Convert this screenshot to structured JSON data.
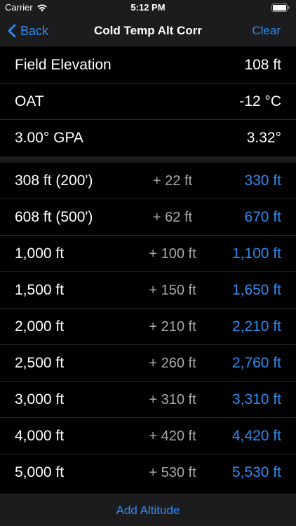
{
  "status": {
    "carrier": "Carrier",
    "time": "5:12 PM"
  },
  "nav": {
    "back_label": "Back",
    "title": "Cold Temp Alt Corr",
    "clear_label": "Clear"
  },
  "inputs": [
    {
      "label": "Field Elevation",
      "value": "108 ft"
    },
    {
      "label": "OAT",
      "value": "-12 °C"
    },
    {
      "label": "3.00° GPA",
      "value": "3.32°"
    }
  ],
  "altitudes": [
    {
      "altitude": "308 ft  (200')",
      "correction": "+ 22 ft",
      "corrected": "330 ft"
    },
    {
      "altitude": "608 ft  (500')",
      "correction": "+ 62 ft",
      "corrected": "670 ft"
    },
    {
      "altitude": "1,000 ft",
      "correction": "+ 100 ft",
      "corrected": "1,100 ft"
    },
    {
      "altitude": "1,500 ft",
      "correction": "+ 150 ft",
      "corrected": "1,650 ft"
    },
    {
      "altitude": "2,000 ft",
      "correction": "+ 210 ft",
      "corrected": "2,210 ft"
    },
    {
      "altitude": "2,500 ft",
      "correction": "+ 260 ft",
      "corrected": "2,760 ft"
    },
    {
      "altitude": "3,000 ft",
      "correction": "+ 310 ft",
      "corrected": "3,310 ft"
    },
    {
      "altitude": "4,000 ft",
      "correction": "+ 420 ft",
      "corrected": "4,420 ft"
    },
    {
      "altitude": "5,000 ft",
      "correction": "+ 530 ft",
      "corrected": "5,530 ft"
    }
  ],
  "footer": {
    "add_label": "Add Altitude"
  },
  "colors": {
    "accent": "#2f8cf0",
    "background": "#000000",
    "bar": "#1c1c1e",
    "secondary_text": "#a8a8ad"
  }
}
